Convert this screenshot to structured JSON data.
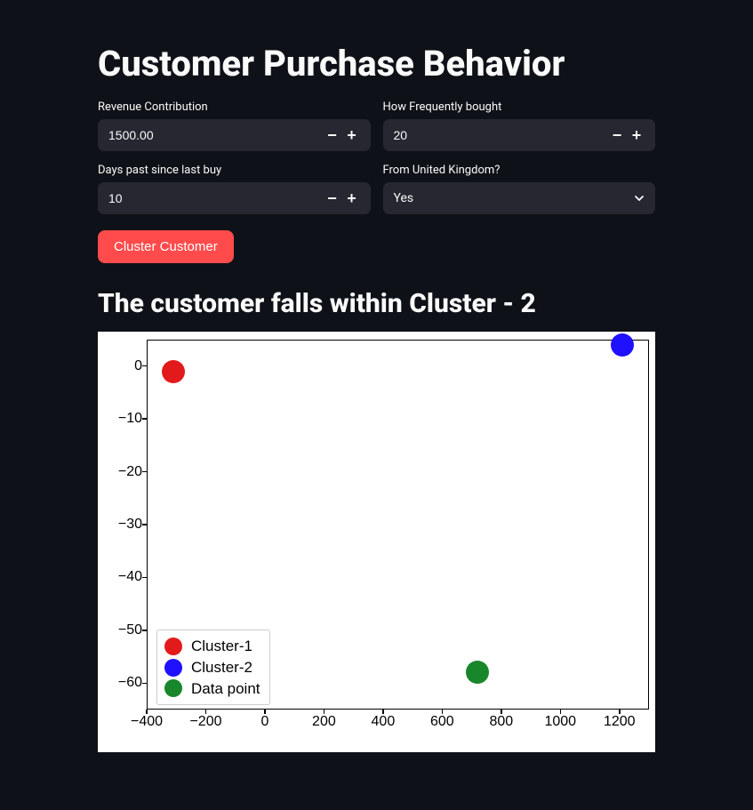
{
  "title": "Customer Purchase Behavior",
  "fields": {
    "revenue": {
      "label": "Revenue Contribution",
      "value": "1500.00"
    },
    "freq": {
      "label": "How Frequently bought",
      "value": "20"
    },
    "days": {
      "label": "Days past since last buy",
      "value": "10"
    },
    "uk": {
      "label": "From United Kingdom?",
      "value": "Yes"
    }
  },
  "button_label": "Cluster Customer",
  "result_heading": "The customer falls within Cluster - 2",
  "chart_data": {
    "type": "scatter",
    "xlabel": "",
    "ylabel": "",
    "xlim": [
      -400,
      1300
    ],
    "ylim": [
      -65,
      5
    ],
    "x_ticks": [
      -400,
      -200,
      0,
      200,
      400,
      600,
      800,
      1000,
      1200
    ],
    "y_ticks": [
      0,
      -10,
      -20,
      -30,
      -40,
      -50,
      -60
    ],
    "series": [
      {
        "name": "Cluster-1",
        "color": "#e31a1c",
        "x": [
          -310
        ],
        "y": [
          -1
        ]
      },
      {
        "name": "Cluster-2",
        "color": "#1f10ff",
        "x": [
          1210
        ],
        "y": [
          4
        ]
      },
      {
        "name": "Data point",
        "color": "#18862a",
        "x": [
          720
        ],
        "y": [
          -58
        ]
      }
    ],
    "legend_position": "lower-left"
  }
}
